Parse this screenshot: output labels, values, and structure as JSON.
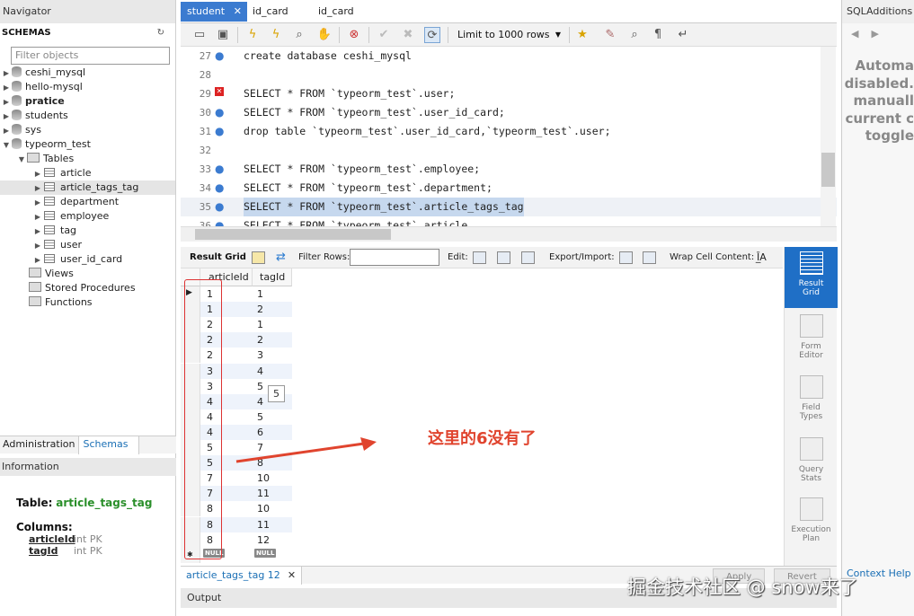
{
  "navigator": {
    "title": "Navigator",
    "schemas_label": "SCHEMAS",
    "filter_placeholder": "Filter objects",
    "schemas": [
      "ceshi_mysql",
      "hello-mysql",
      "pratice",
      "students",
      "sys",
      "typeorm_test"
    ],
    "tables_label": "Tables",
    "tables": [
      "article",
      "article_tags_tag",
      "department",
      "employee",
      "tag",
      "user",
      "user_id_card"
    ],
    "views_label": "Views",
    "procs_label": "Stored Procedures",
    "funcs_label": "Functions",
    "bottom_tabs": [
      "Administration",
      "Schemas"
    ],
    "info_title": "Information",
    "info": {
      "table_label": "Table:",
      "table_name": "article_tags_tag",
      "columns_label": "Columns:",
      "columns": [
        {
          "name": "articleId",
          "type": "int PK"
        },
        {
          "name": "tagId",
          "type": "int PK"
        }
      ]
    }
  },
  "tabs": [
    "student",
    "id_card",
    "id_card"
  ],
  "toolbar": {
    "limit_label": "Limit to 1000 rows"
  },
  "editor": {
    "lines": [
      {
        "num": "27",
        "marker": "dot",
        "code": "create database ceshi_mysql"
      },
      {
        "num": "28",
        "marker": "",
        "code": ""
      },
      {
        "num": "29",
        "marker": "err",
        "code": "SELECT * FROM `typeorm_test`.user;"
      },
      {
        "num": "30",
        "marker": "dot",
        "code": "SELECT * FROM `typeorm_test`.user_id_card;"
      },
      {
        "num": "31",
        "marker": "dot",
        "code": "drop table `typeorm_test`.user_id_card,`typeorm_test`.user;"
      },
      {
        "num": "32",
        "marker": "",
        "code": ""
      },
      {
        "num": "33",
        "marker": "dot",
        "code": "SELECT * FROM `typeorm_test`.employee;"
      },
      {
        "num": "34",
        "marker": "dot",
        "code": "SELECT * FROM `typeorm_test`.department;"
      },
      {
        "num": "35",
        "marker": "dot",
        "code": "SELECT * FROM `typeorm_test`.article_tags_tag"
      },
      {
        "num": "36",
        "marker": "dot",
        "code": "SELECT * FROM `typeorm_test`.article"
      }
    ]
  },
  "result_toolbar": {
    "result_grid": "Result Grid",
    "filter_rows": "Filter Rows:",
    "edit": "Edit:",
    "export_import": "Export/Import:",
    "wrap": "Wrap Cell Content:"
  },
  "grid": {
    "columns": [
      "articleId",
      "tagId"
    ],
    "rows": [
      [
        "1",
        "1"
      ],
      [
        "1",
        "2"
      ],
      [
        "2",
        "1"
      ],
      [
        "2",
        "2"
      ],
      [
        "2",
        "3"
      ],
      [
        "3",
        "4"
      ],
      [
        "3",
        "5"
      ],
      [
        "4",
        "4"
      ],
      [
        "4",
        "5"
      ],
      [
        "4",
        "6"
      ],
      [
        "5",
        "7"
      ],
      [
        "5",
        "8"
      ],
      [
        "7",
        "10"
      ],
      [
        "7",
        "11"
      ],
      [
        "8",
        "10"
      ],
      [
        "8",
        "11"
      ],
      [
        "8",
        "12"
      ]
    ],
    "null_label": "NULL",
    "tooltip": "5"
  },
  "annotation": "这里的6没有了",
  "side_buttons": [
    {
      "label1": "Result",
      "label2": "Grid"
    },
    {
      "label1": "Form",
      "label2": "Editor"
    },
    {
      "label1": "Field",
      "label2": "Types"
    },
    {
      "label1": "Query",
      "label2": "Stats"
    },
    {
      "label1": "Execution",
      "label2": "Plan"
    }
  ],
  "bottom": {
    "result_tab": "article_tags_tag 12",
    "apply": "Apply",
    "revert": "Revert",
    "output": "Output"
  },
  "sql_additions": {
    "title": "SQLAdditions",
    "message_lines": [
      "Automa",
      "disabled.",
      "manuall",
      "current c",
      "toggle"
    ],
    "context_help": "Context Help"
  },
  "watermark": "掘金技术社区 @ snow来了",
  "colors": {
    "accent": "#3b7bd0",
    "annotation": "#e0442e"
  }
}
